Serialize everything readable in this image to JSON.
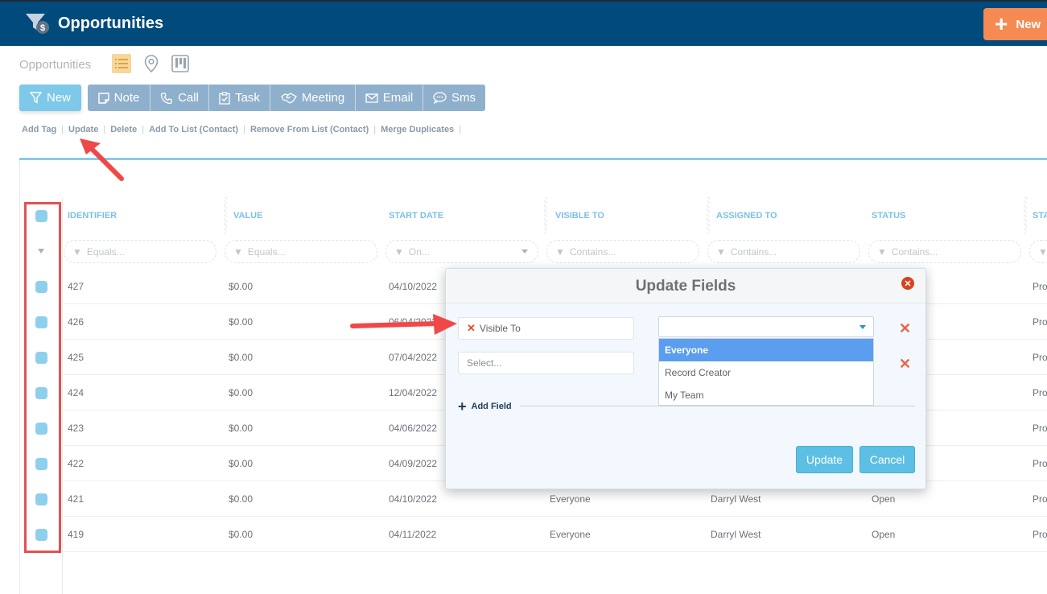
{
  "header": {
    "title": "Opportunities",
    "new_label": "New"
  },
  "subbar": {
    "page_label": "Opportunities"
  },
  "actions": {
    "new_label": "New",
    "buttons": [
      "Note",
      "Call",
      "Task",
      "Meeting",
      "Email",
      "Sms"
    ]
  },
  "links": [
    "Add Tag",
    "Update",
    "Delete",
    "Add To List (Contact)",
    "Remove From List (Contact)",
    "Merge Duplicates"
  ],
  "table": {
    "columns": [
      "IDENTIFIER",
      "VALUE",
      "START DATE",
      "VISIBLE TO",
      "ASSIGNED TO",
      "STATUS",
      "STA"
    ],
    "filters": [
      "Equals...",
      "Equals...",
      "On...",
      "Contains...",
      "Contains...",
      "Contains..."
    ],
    "rows": [
      {
        "id": "427",
        "value": "$0.00",
        "start": "04/10/2022",
        "visible": "",
        "assigned": "",
        "status": "",
        "stage": "Pro"
      },
      {
        "id": "426",
        "value": "$0.00",
        "start": "06/04/2022",
        "visible": "",
        "assigned": "",
        "status": "",
        "stage": "Pro"
      },
      {
        "id": "425",
        "value": "$0.00",
        "start": "07/04/2022",
        "visible": "",
        "assigned": "",
        "status": "",
        "stage": "Pro"
      },
      {
        "id": "424",
        "value": "$0.00",
        "start": "12/04/2022",
        "visible": "",
        "assigned": "",
        "status": "",
        "stage": "Pro"
      },
      {
        "id": "423",
        "value": "$0.00",
        "start": "04/06/2022",
        "visible": "",
        "assigned": "",
        "status": "",
        "stage": "Pro"
      },
      {
        "id": "422",
        "value": "$0.00",
        "start": "04/09/2022",
        "visible": "",
        "assigned": "",
        "status": "",
        "stage": "Pro"
      },
      {
        "id": "421",
        "value": "$0.00",
        "start": "04/10/2022",
        "visible": "Everyone",
        "assigned": "Darryl West",
        "status": "Open",
        "stage": "Pro"
      },
      {
        "id": "419",
        "value": "$0.00",
        "start": "04/11/2022",
        "visible": "Everyone",
        "assigned": "Darryl West",
        "status": "Open",
        "stage": "Pro"
      }
    ]
  },
  "modal": {
    "title": "Update Fields",
    "field1": "Visible To",
    "field2_placeholder": "Select...",
    "dropdown_value": "",
    "options": [
      "Everyone",
      "Record Creator",
      "My Team"
    ],
    "selected_option": "Everyone",
    "add_field": "Add Field",
    "update_label": "Update",
    "cancel_label": "Cancel"
  },
  "colors": {
    "header_bg": "#004a7c",
    "accent": "#7ec8ea",
    "new_orange": "#f58a53",
    "annotation_red": "#e05252"
  }
}
